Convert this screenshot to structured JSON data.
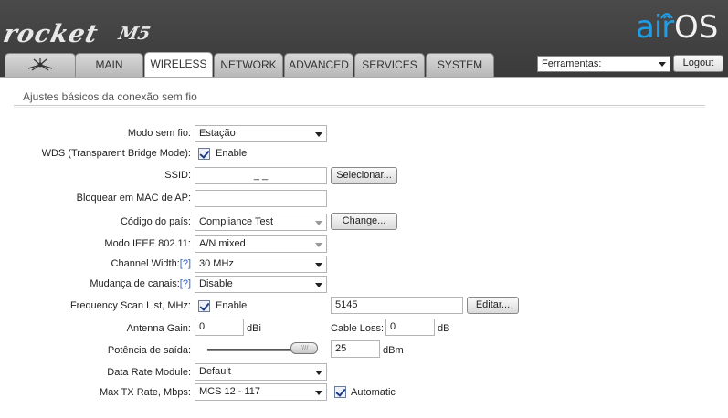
{
  "brand": {
    "product": "rocket",
    "model": "M5",
    "os_air": "air",
    "os_os": "OS"
  },
  "tabs": [
    {
      "label": ""
    },
    {
      "label": "MAIN"
    },
    {
      "label": "WIRELESS"
    },
    {
      "label": "NETWORK"
    },
    {
      "label": "ADVANCED"
    },
    {
      "label": "SERVICES"
    },
    {
      "label": "SYSTEM"
    }
  ],
  "active_tab": "WIRELESS",
  "tools": {
    "selected": "Ferramentas:",
    "logout": "Logout"
  },
  "section": {
    "title": "Ajustes básicos da conexão sem fio"
  },
  "form": {
    "wireless_mode": {
      "label": "Modo sem fio:",
      "value": "Estação"
    },
    "wds": {
      "label": "WDS (Transparent Bridge Mode):",
      "checked": true,
      "check_label": "Enable"
    },
    "ssid": {
      "label": "SSID:",
      "value": "_ _",
      "button": "Selecionar..."
    },
    "lock_ap_mac": {
      "label": "Bloquear em MAC de AP:",
      "value": ""
    },
    "country": {
      "label": "Código do país:",
      "value": "Compliance Test",
      "button": "Change..."
    },
    "ieee_mode": {
      "label": "Modo IEEE 802.11:",
      "value": "A/N mixed"
    },
    "channel_width": {
      "label": "Channel Width:",
      "help": "[?]",
      "value": "30 MHz"
    },
    "channel_shift": {
      "label": "Mudança de canais:",
      "help": "[?]",
      "value": "Disable"
    },
    "freq_scan": {
      "label": "Frequency Scan List, MHz:",
      "checked": true,
      "check_label": "Enable",
      "value": "5145",
      "button": "Editar..."
    },
    "antenna_gain": {
      "label": "Antenna Gain:",
      "value": "0",
      "unit": "dBi"
    },
    "cable_loss": {
      "label": "Cable Loss:",
      "value": "0",
      "unit": "dB"
    },
    "output_power": {
      "label": "Potência de saída:",
      "value": "25",
      "unit": "dBm",
      "slider_fraction": 0.88
    },
    "data_rate_module": {
      "label": "Data Rate Module:",
      "value": "Default"
    },
    "max_tx_rate": {
      "label": "Max TX Rate, Mbps:",
      "value": "MCS 12 - 117",
      "checked": true,
      "check_label": "Automatic"
    }
  }
}
